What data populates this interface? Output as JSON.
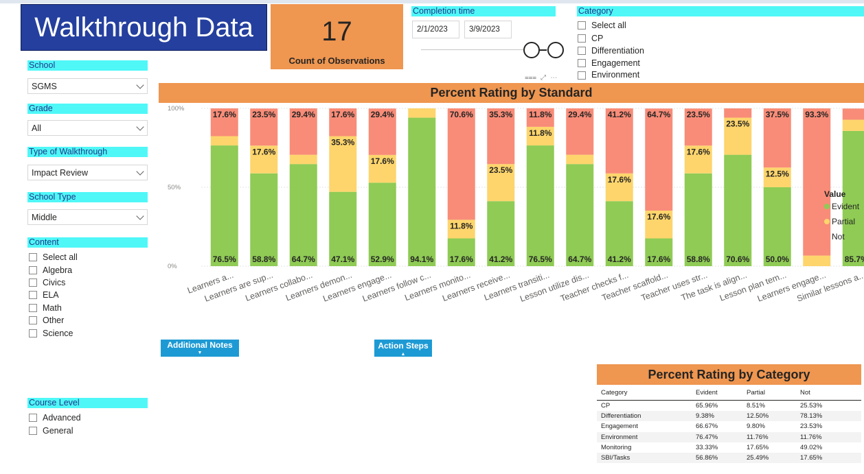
{
  "dashboard": {
    "title": "Walkthrough Data",
    "count_value": "17",
    "count_label": "Count of Observations"
  },
  "completion_time": {
    "label": "Completion time",
    "start_date": "2/1/2023",
    "end_date": "3/9/2023"
  },
  "category_filter": {
    "label": "Category",
    "items": [
      "Select all",
      "CP",
      "Differentiation",
      "Engagement",
      "Environment"
    ]
  },
  "filters": {
    "school": {
      "label": "School",
      "value": "SGMS"
    },
    "grade": {
      "label": "Grade",
      "value": "All"
    },
    "walkthrough_type": {
      "label": "Type of Walkthrough",
      "value": "Impact Review"
    },
    "school_type": {
      "label": "School Type",
      "value": "Middle"
    }
  },
  "content_filter": {
    "label": "Content",
    "items": [
      "Select all",
      "Algebra",
      "Civics",
      "ELA",
      "Math",
      "Other",
      "Science"
    ]
  },
  "course_level_filter": {
    "label": "Course Level",
    "items": [
      "Advanced",
      "General"
    ]
  },
  "buttons": {
    "additional_notes": "Additional Notes",
    "action_steps": "Action Steps"
  },
  "visual_header_icons": [
    "filter-icon",
    "focus-mode-icon",
    "more-options-icon"
  ],
  "colors": {
    "evident": "#8fcb55",
    "partial": "#fdd56c",
    "not": "#f88c78",
    "accent": "#ef9650",
    "header_cyan": "#4ff7f7",
    "title_blue": "#243f9e"
  },
  "chart_data": {
    "type": "bar",
    "stacked": true,
    "title": "Percent Rating by Standard",
    "ylabel": "",
    "ylim": [
      0,
      100
    ],
    "yticks": [
      "0%",
      "50%",
      "100%"
    ],
    "legend_title": "Value",
    "legend_position": "right",
    "categories": [
      "Learners a...",
      "Learners are sup...",
      "Learners collabo...",
      "Learners demon...",
      "Learners engage...",
      "Learners follow c...",
      "Learners monito...",
      "Learners receive...",
      "Learners transiti...",
      "Lesson utilize dis...",
      "Teacher checks f...",
      "Teacher scaffold...",
      "Teacher uses str...",
      "The task is align...",
      "Lesson plan tem...",
      "Learners engage...",
      "Similar lessons a..."
    ],
    "series": [
      {
        "name": "Evident",
        "values": [
          76.5,
          58.8,
          64.7,
          47.1,
          52.9,
          94.1,
          17.6,
          41.2,
          76.5,
          64.7,
          41.2,
          17.6,
          58.8,
          70.6,
          50.0,
          0,
          85.7
        ],
        "labels": [
          "76.5%",
          "58.8%",
          "64.7%",
          "47.1%",
          "52.9%",
          "94.1%",
          "17.6%",
          "41.2%",
          "76.5%",
          "64.7%",
          "41.2%",
          "17.6%",
          "58.8%",
          "70.6%",
          "50.0%",
          "",
          "85.7%"
        ]
      },
      {
        "name": "Partial",
        "values": [
          5.9,
          17.6,
          5.9,
          35.3,
          17.6,
          5.9,
          11.8,
          23.5,
          11.8,
          5.9,
          17.6,
          17.6,
          17.6,
          23.5,
          12.5,
          6.7,
          7.1
        ],
        "labels": [
          "",
          "17.6%",
          "",
          "35.3%",
          "17.6%",
          "",
          "11.8%",
          "23.5%",
          "11.8%",
          "",
          "17.6%",
          "17.6%",
          "17.6%",
          "23.5%",
          "12.5%",
          "",
          ""
        ]
      },
      {
        "name": "Not",
        "values": [
          17.6,
          23.5,
          29.4,
          17.6,
          29.4,
          0,
          70.6,
          35.3,
          11.8,
          29.4,
          41.2,
          64.7,
          23.5,
          5.9,
          37.5,
          93.3,
          7.1
        ],
        "labels": [
          "17.6%",
          "23.5%",
          "29.4%",
          "17.6%",
          "29.4%",
          "",
          "70.6%",
          "35.3%",
          "11.8%",
          "29.4%",
          "41.2%",
          "64.7%",
          "23.5%",
          "",
          "37.5%",
          "93.3%",
          ""
        ]
      }
    ]
  },
  "category_table": {
    "title": "Percent Rating by Category",
    "columns": [
      "Category",
      "Evident",
      "Partial",
      "Not"
    ],
    "rows": [
      [
        "CP",
        "65.96%",
        "8.51%",
        "25.53%"
      ],
      [
        "Differentiation",
        "9.38%",
        "12.50%",
        "78.13%"
      ],
      [
        "Engagement",
        "66.67%",
        "9.80%",
        "23.53%"
      ],
      [
        "Environment",
        "76.47%",
        "11.76%",
        "11.76%"
      ],
      [
        "Monitoring",
        "33.33%",
        "17.65%",
        "49.02%"
      ],
      [
        "SBI/Tasks",
        "56.86%",
        "25.49%",
        "17.65%"
      ]
    ]
  }
}
